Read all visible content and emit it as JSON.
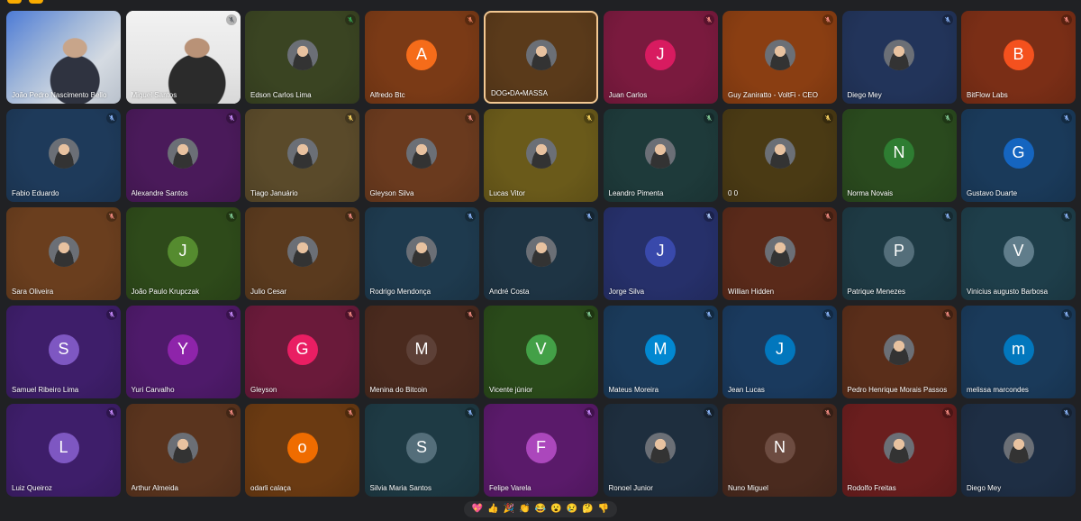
{
  "participants": [
    {
      "name": "João Pedro Nascimento Bello",
      "type": "camera",
      "camera": "cam1",
      "bg": "#2a2d33"
    },
    {
      "name": "Miguel Santos",
      "type": "camera",
      "camera": "cam2",
      "bg": "#e6e6e6",
      "mic_color": "#5f6368"
    },
    {
      "name": "Edson Carlos Lima",
      "type": "photo",
      "bg": "#3a4422",
      "mic_color": "#34a853"
    },
    {
      "name": "Alfredo Btc",
      "type": "letter",
      "letter": "A",
      "avatar_color": "#f56c1a",
      "bg": "#7a3a16",
      "mic_color": "#ea8060"
    },
    {
      "name": "DOG•DA•MASSA",
      "type": "photo",
      "bg": "#5a3a1a",
      "speaking": true
    },
    {
      "name": "Juan Carlos",
      "type": "letter",
      "letter": "J",
      "avatar_color": "#d81b60",
      "bg": "#7a1a3e",
      "mic_color": "#f28b82"
    },
    {
      "name": "Guy Zaniratto - VoltFi - CEO",
      "type": "photo",
      "bg": "#8a3e12",
      "mic_color": "#f28b82"
    },
    {
      "name": "Diego Mey",
      "type": "photo",
      "bg": "#22345a",
      "mic_color": "#8ab4f8"
    },
    {
      "name": "BitFlow Labs",
      "type": "letter",
      "letter": "B",
      "avatar_color": "#f4511e",
      "bg": "#7a2e16",
      "mic_color": "#f28b82"
    },
    {
      "name": "Fabio Eduardo",
      "type": "photo",
      "bg": "#1e3a5a",
      "mic_color": "#8ab4f8"
    },
    {
      "name": "Alexandre Santos",
      "type": "photo",
      "bg": "#4a1a5a",
      "mic_color": "#c58af9"
    },
    {
      "name": "Tiago Januário",
      "type": "photo",
      "bg": "#5a4a2a",
      "mic_color": "#fdd663"
    },
    {
      "name": "Gleyson Silva",
      "type": "photo",
      "bg": "#6a3a1e",
      "mic_color": "#f28b82"
    },
    {
      "name": "Lucas Vitor",
      "type": "photo",
      "bg": "#6a5a1a",
      "mic_color": "#fdd663"
    },
    {
      "name": "Leandro Pimenta",
      "type": "photo",
      "bg": "#1e3a3a",
      "mic_color": "#81c995"
    },
    {
      "name": "0 0",
      "type": "photo",
      "bg": "#4a3a14",
      "mic_color": "#fdd663"
    },
    {
      "name": "Norma Novais",
      "type": "letter",
      "letter": "N",
      "avatar_color": "#2e7d32",
      "bg": "#2a4a1e",
      "mic_color": "#81c995"
    },
    {
      "name": "Gustavo Duarte",
      "type": "letter",
      "letter": "G",
      "avatar_color": "#1565c0",
      "bg": "#1a3a5a",
      "mic_color": "#8ab4f8"
    },
    {
      "name": "Sara Oliveira",
      "type": "photo",
      "bg": "#6a3e1e",
      "mic_color": "#f28b82"
    },
    {
      "name": "João Paulo Krupczak",
      "type": "letter",
      "letter": "J",
      "avatar_color": "#558b2f",
      "bg": "#2e4a1a",
      "mic_color": "#81c995"
    },
    {
      "name": "Julio Cesar",
      "type": "photo",
      "bg": "#5a3a1e",
      "mic_color": "#f28b82"
    },
    {
      "name": "Rodrigo Mendonça",
      "type": "photo",
      "bg": "#1e3a4e",
      "mic_color": "#8ab4f8"
    },
    {
      "name": "André Costa",
      "type": "photo",
      "bg": "#1e3444",
      "mic_color": "#8ab4f8"
    },
    {
      "name": "Jorge Silva",
      "type": "letter",
      "letter": "J",
      "avatar_color": "#3949ab",
      "bg": "#26306a",
      "mic_color": "#aecbfa"
    },
    {
      "name": "Willian Hidden",
      "type": "photo",
      "bg": "#5a2a1a",
      "mic_color": "#f28b82"
    },
    {
      "name": "Patrique Menezes",
      "type": "letter",
      "letter": "P",
      "avatar_color": "#546e7a",
      "bg": "#1e3a44",
      "mic_color": "#8ab4f8"
    },
    {
      "name": "Vinicius augusto Barbosa",
      "type": "letter",
      "letter": "V",
      "avatar_color": "#607d8b",
      "bg": "#1e3e4a",
      "mic_color": "#8ab4f8"
    },
    {
      "name": "Samuel Ribeiro Lima",
      "type": "letter",
      "letter": "S",
      "avatar_color": "#7e57c2",
      "bg": "#3e1e6a",
      "mic_color": "#c58af9"
    },
    {
      "name": "Yuri Carvalho",
      "type": "letter",
      "letter": "Y",
      "avatar_color": "#8e24aa",
      "bg": "#4e1a6a",
      "mic_color": "#c58af9"
    },
    {
      "name": "Gleyson",
      "type": "letter",
      "letter": "G",
      "avatar_color": "#e91e63",
      "bg": "#6a1a3a",
      "mic_color": "#f28b82"
    },
    {
      "name": "Menina do Bitcoin",
      "type": "letter",
      "letter": "M",
      "avatar_color": "#5d4037",
      "bg": "#4a2a1e",
      "mic_color": "#f28b82"
    },
    {
      "name": "Vicente júnior",
      "type": "letter",
      "letter": "V",
      "avatar_color": "#43a047",
      "bg": "#2a4a1a",
      "mic_color": "#81c995"
    },
    {
      "name": "Mateus Moreira",
      "type": "letter",
      "letter": "M",
      "avatar_color": "#0288d1",
      "bg": "#1a3a5a",
      "mic_color": "#8ab4f8"
    },
    {
      "name": "Jean Lucas",
      "type": "letter",
      "letter": "J",
      "avatar_color": "#0277bd",
      "bg": "#1a3a5e",
      "mic_color": "#8ab4f8"
    },
    {
      "name": "Pedro Henrique Morais Passos",
      "type": "photo",
      "bg": "#5a2e1a",
      "mic_color": "#f28b82"
    },
    {
      "name": "melissa marcondes",
      "type": "letter",
      "letter": "m",
      "avatar_color": "#0277bd",
      "bg": "#1a3a5a",
      "mic_color": "#8ab4f8"
    },
    {
      "name": "Luiz Queiroz",
      "type": "letter",
      "letter": "L",
      "avatar_color": "#7e57c2",
      "bg": "#3e1e6a",
      "mic_color": "#c58af9"
    },
    {
      "name": "Arthur Almeida",
      "type": "photo",
      "bg": "#5a341e",
      "mic_color": "#f28b82"
    },
    {
      "name": "odarli calaça",
      "type": "letter",
      "letter": "o",
      "avatar_color": "#ef6c00",
      "bg": "#6a3a12",
      "mic_color": "#f28b82"
    },
    {
      "name": "Silvia Maria Santos",
      "type": "letter",
      "letter": "S",
      "avatar_color": "#546e7a",
      "bg": "#1e3a44",
      "mic_color": "#8ab4f8"
    },
    {
      "name": "Felipe Varela",
      "type": "letter",
      "letter": "F",
      "avatar_color": "#ab47bc",
      "bg": "#5a1a6a",
      "mic_color": "#c58af9"
    },
    {
      "name": "Ronoel Junior",
      "type": "photo",
      "bg": "#1e2e3e",
      "mic_color": "#8ab4f8"
    },
    {
      "name": "Nuno Miguel",
      "type": "letter",
      "letter": "N",
      "avatar_color": "#6d4c41",
      "bg": "#4a2a1e",
      "mic_color": "#f28b82"
    },
    {
      "name": "Rodolfo Freitas",
      "type": "photo",
      "bg": "#6a1e1e",
      "mic_color": "#f28b82"
    },
    {
      "name": "Diego Mey",
      "type": "photo",
      "bg": "#1e2e44",
      "mic_color": "#8ab4f8"
    }
  ],
  "reactions": [
    {
      "emoji": "💖",
      "name": "sparkling-heart-reaction"
    },
    {
      "emoji": "👍",
      "name": "thumbs-up-reaction"
    },
    {
      "emoji": "🎉",
      "name": "party-popper-reaction"
    },
    {
      "emoji": "👏",
      "name": "clapping-hands-reaction"
    },
    {
      "emoji": "😂",
      "name": "joy-reaction"
    },
    {
      "emoji": "😮",
      "name": "surprised-reaction"
    },
    {
      "emoji": "😢",
      "name": "crying-reaction"
    },
    {
      "emoji": "🤔",
      "name": "thinking-reaction"
    },
    {
      "emoji": "👎",
      "name": "thumbs-down-reaction"
    }
  ],
  "colors": {
    "background": "#202124",
    "accent": "#f9ab00",
    "speaking_border": "#f3c892"
  }
}
